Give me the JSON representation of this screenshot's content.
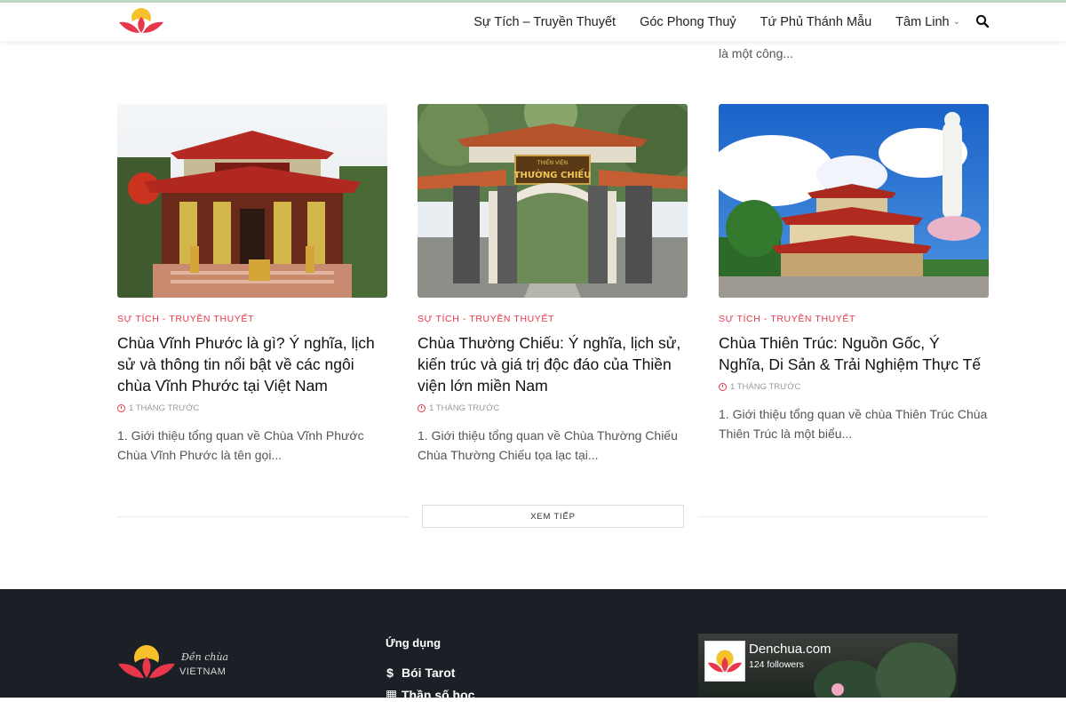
{
  "header": {
    "nav": [
      {
        "label": "Sự Tích – Truyền Thuyết"
      },
      {
        "label": "Góc Phong Thuỷ"
      },
      {
        "label": "Tứ Phủ Thánh Mẫu"
      },
      {
        "label": "Tâm Linh"
      }
    ]
  },
  "peek": {
    "excerpt_tail": "là một công..."
  },
  "cards": [
    {
      "category": "Sự Tích - Truyền Thuyết",
      "title": "Chùa Vĩnh Phước là gì? Ý nghĩa, lịch sử và thông tin nổi bật về các ngôi chùa Vĩnh Phước tại Việt Nam",
      "time": "1 tháng trước",
      "excerpt": "1. Giới thiệu tổng quan về Chùa Vĩnh Phước Chùa Vĩnh Phước là tên gọi..."
    },
    {
      "category": "Sự Tích - Truyền Thuyết",
      "title": "Chùa Thường Chiếu: Ý nghĩa, lịch sử, kiến trúc và giá trị độc đáo của Thiền viện lớn miền Nam",
      "time": "1 tháng trước",
      "sign_top": "THIỀN VIỆN",
      "sign_main": "THƯỜNG CHIẾU",
      "excerpt": "1. Giới thiệu tổng quan về Chùa Thường Chiếu Chùa Thường Chiếu tọa lạc tại..."
    },
    {
      "category": "Sự Tích - Truyền Thuyết",
      "title": "Chùa Thiên Trúc: Nguồn Gốc, Ý Nghĩa, Di Sản & Trải Nghiệm Thực Tế",
      "time": "1 tháng trước",
      "excerpt": "1. Giới thiệu tổng quan về chùa Thiên Trúc Chùa Thiên Trúc là một biểu..."
    }
  ],
  "load_more": {
    "label": "Xem tiếp"
  },
  "footer": {
    "logo_script": "Đền chùa",
    "logo_text": "VIETNAM",
    "apps_heading": "Ứng dụng",
    "apps": [
      {
        "icon": "$",
        "label": "Bói Tarot"
      },
      {
        "icon": "▦",
        "label": "Thần số học"
      }
    ],
    "fb": {
      "name": "Denchua.com",
      "followers": "124 followers"
    }
  },
  "colors": {
    "accent": "#e8364a",
    "footer_bg": "#1b1f26",
    "lotus_yellow": "#f6c12b",
    "lotus_red": "#e8364a"
  }
}
